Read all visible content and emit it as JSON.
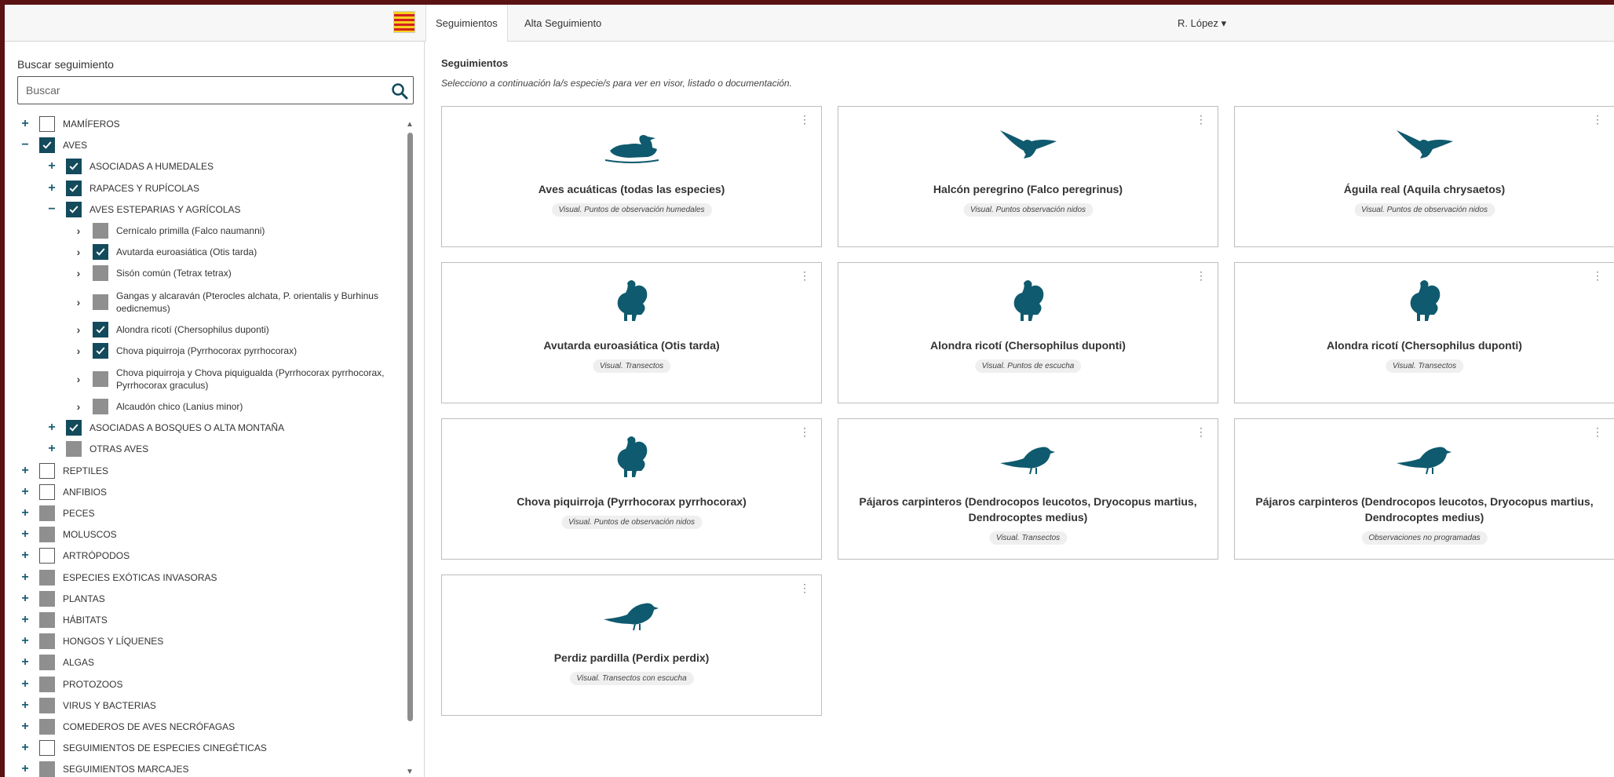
{
  "nav": {
    "tabs": [
      "Seguimientos",
      "Alta Seguimiento"
    ],
    "user": "R. López ▾"
  },
  "search": {
    "label": "Buscar seguimiento",
    "placeholder": "Buscar"
  },
  "tree": [
    {
      "expander": "+",
      "check": "empty",
      "label": "MAMÍFEROS",
      "level": 0
    },
    {
      "expander": "−",
      "check": "checked",
      "label": "AVES",
      "level": 0
    },
    {
      "expander": "+",
      "check": "checked",
      "label": "ASOCIADAS A HUMEDALES",
      "level": 1
    },
    {
      "expander": "+",
      "check": "checked",
      "label": "RAPACES Y RUPÍCOLAS",
      "level": 1
    },
    {
      "expander": "−",
      "check": "checked",
      "label": "AVES ESTEPARIAS Y AGRÍCOLAS",
      "level": 1
    },
    {
      "expander": "›",
      "check": "partial",
      "label": "Cernícalo primilla (Falco naumanni)",
      "level": 2
    },
    {
      "expander": "›",
      "check": "checked",
      "label": "Avutarda euroasiática (Otis tarda)",
      "level": 2
    },
    {
      "expander": "›",
      "check": "partial",
      "label": "Sisón común (Tetrax tetrax)",
      "level": 2
    },
    {
      "expander": "›",
      "check": "partial",
      "label": "Gangas y alcaraván (Pterocles alchata, P. orientalis y Burhinus oedicnemus)",
      "level": 2,
      "tall": true
    },
    {
      "expander": "›",
      "check": "checked",
      "label": "Alondra ricotí (Chersophilus duponti)",
      "level": 2
    },
    {
      "expander": "›",
      "check": "checked",
      "label": "Chova piquirroja (Pyrrhocorax pyrrhocorax)",
      "level": 2
    },
    {
      "expander": "›",
      "check": "partial",
      "label": "Chova piquirroja y Chova piquigualda (Pyrrhocorax pyrrhocorax, Pyrrhocorax graculus)",
      "level": 2,
      "tall": true
    },
    {
      "expander": "›",
      "check": "partial",
      "label": "Alcaudón chico (Lanius minor)",
      "level": 2
    },
    {
      "expander": "+",
      "check": "checked",
      "label": "ASOCIADAS A BOSQUES O ALTA MONTAÑA",
      "level": 1
    },
    {
      "expander": "+",
      "check": "partial",
      "label": "OTRAS AVES",
      "level": 1
    },
    {
      "expander": "+",
      "check": "empty",
      "label": "REPTILES",
      "level": 0
    },
    {
      "expander": "+",
      "check": "empty",
      "label": "ANFIBIOS",
      "level": 0
    },
    {
      "expander": "+",
      "check": "partial",
      "label": "PECES",
      "level": 0
    },
    {
      "expander": "+",
      "check": "partial",
      "label": "MOLUSCOS",
      "level": 0
    },
    {
      "expander": "+",
      "check": "empty",
      "label": "ARTRÓPODOS",
      "level": 0
    },
    {
      "expander": "+",
      "check": "partial",
      "label": "ESPECIES EXÓTICAS INVASORAS",
      "level": 0
    },
    {
      "expander": "+",
      "check": "partial",
      "label": "PLANTAS",
      "level": 0
    },
    {
      "expander": "+",
      "check": "partial",
      "label": "HÁBITATS",
      "level": 0
    },
    {
      "expander": "+",
      "check": "partial",
      "label": "HONGOS Y LÍQUENES",
      "level": 0
    },
    {
      "expander": "+",
      "check": "partial",
      "label": "ALGAS",
      "level": 0
    },
    {
      "expander": "+",
      "check": "partial",
      "label": "PROTOZOOS",
      "level": 0
    },
    {
      "expander": "+",
      "check": "partial",
      "label": "VIRUS Y BACTERIAS",
      "level": 0
    },
    {
      "expander": "+",
      "check": "partial",
      "label": "COMEDEROS DE AVES NECRÓFAGAS",
      "level": 0
    },
    {
      "expander": "+",
      "check": "empty",
      "label": "SEGUIMIENTOS DE ESPECIES CINEGÉTICAS",
      "level": 0
    },
    {
      "expander": "+",
      "check": "partial",
      "label": "SEGUIMIENTOS MARCAJES",
      "level": 0
    }
  ],
  "main": {
    "title": "Seguimientos",
    "subtitle": "Selecciono a continuación la/s especie/s para ver en visor, listado o documentación."
  },
  "cards": [
    {
      "title": "Aves acuáticas (todas las especies)",
      "badge": "Visual. Puntos de observación humedales",
      "icon": "duck-icon"
    },
    {
      "title": "Halcón peregrino (Falco peregrinus)",
      "badge": "Visual. Puntos observación nidos",
      "icon": "raptor-icon"
    },
    {
      "title": "Águila real (Aquila chrysaetos)",
      "badge": "Visual. Puntos de observación nidos",
      "icon": "raptor-icon"
    },
    {
      "title": "Avutarda euroasiática (Otis tarda)",
      "badge": "Visual. Transectos",
      "icon": "grouse-icon"
    },
    {
      "title": "Alondra ricotí (Chersophilus duponti)",
      "badge": "Visual. Puntos de escucha",
      "icon": "grouse-icon"
    },
    {
      "title": "Alondra ricotí (Chersophilus duponti)",
      "badge": "Visual. Transectos",
      "icon": "grouse-icon"
    },
    {
      "title": "Chova piquirroja (Pyrrhocorax pyrrhocorax)",
      "badge": "Visual. Puntos de observación nidos",
      "icon": "grouse-icon"
    },
    {
      "title": "Pájaros carpinteros (Dendrocopos leucotos, Dryocopus martius, Dendrocoptes medius)",
      "badge": "Visual. Transectos",
      "icon": "songbird-icon"
    },
    {
      "title": "Pájaros carpinteros (Dendrocopos leucotos, Dryocopus martius, Dendrocoptes medius)",
      "badge": "Observaciones no programadas",
      "icon": "songbird-icon"
    },
    {
      "title": "Perdiz pardilla (Perdix perdix)",
      "badge": "Visual. Transectos con escucha",
      "icon": "songbird-icon"
    }
  ],
  "colors": {
    "accent": "#134a5c",
    "icon": "#0f5a6e",
    "frame": "#5a1212"
  }
}
